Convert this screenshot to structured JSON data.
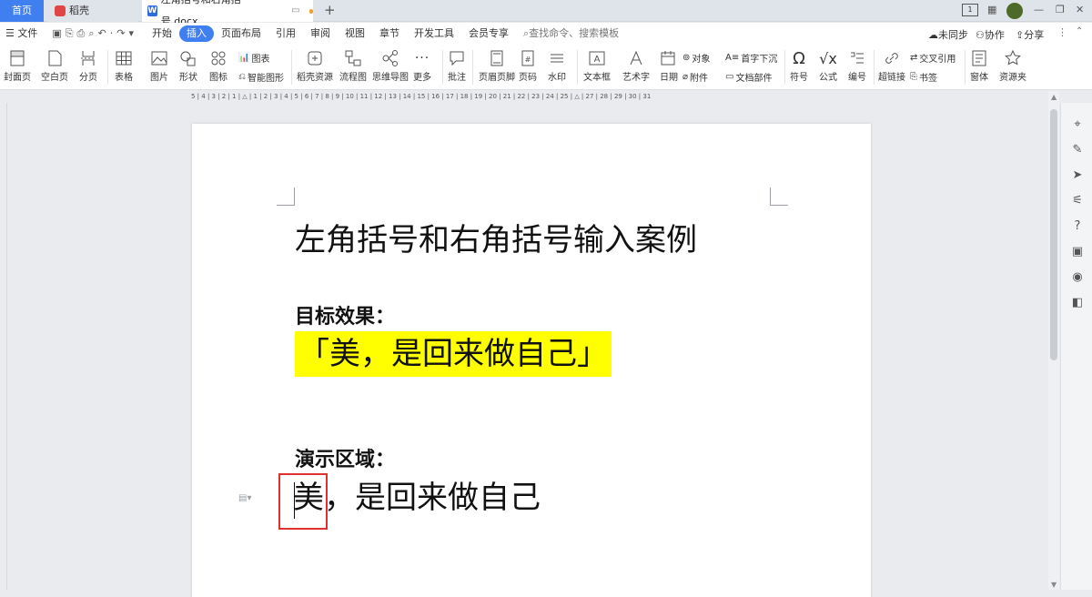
{
  "tabs": {
    "home": "首页",
    "daoke": "稻壳",
    "doc": "左角括号和右角括号.docx",
    "add": "+"
  },
  "window": {
    "page_num": "1",
    "minimize": "—",
    "restore": "❐",
    "close": "✕"
  },
  "menu": {
    "file": "文件",
    "items": [
      "开始",
      "插入",
      "页面布局",
      "引用",
      "审阅",
      "视图",
      "章节",
      "开发工具",
      "会员专享"
    ],
    "active": "插入",
    "search": "查找命令、搜索模板",
    "sync": "未同步",
    "collab": "协作",
    "share": "分享"
  },
  "ribbon": {
    "cover": "封面页",
    "blank": "空白页",
    "pagebreak": "分页",
    "table": "表格",
    "picture": "图片",
    "shape": "形状",
    "icon": "图标",
    "chart": "图表",
    "smartart": "智能图形",
    "daoke_res": "稻壳资源",
    "flowchart": "流程图",
    "mindmap": "思维导图",
    "more": "更多",
    "comment": "批注",
    "header_footer": "页眉页脚",
    "page_num": "页码",
    "watermark": "水印",
    "textbox": "文本框",
    "wordart": "艺术字",
    "date": "日期",
    "object": "对象",
    "attachment": "附件",
    "dropcap": "首字下沉",
    "doc_part": "文档部件",
    "symbol": "符号",
    "formula": "公式",
    "numbering": "编号",
    "cross_ref": "交叉引用",
    "hyperlink": "超链接",
    "bookmark": "书签",
    "window_elem": "窗体",
    "resources": "资源夹"
  },
  "ruler": {
    "text": "5 | 4 | 3 | 2 | 1 | △ | 1 | 2 | 3 | 4 | 5 | 6 | 7 | 8 | 9 | 10 | 11 | 12 | 13 | 14 | 15 | 16 | 17 | 18 | 19 | 20 | 21 | 22 | 23 | 24 | 25 | △ | 27 | 28 | 29 | 30 | 31"
  },
  "document": {
    "title": "左角括号和右角括号输入案例",
    "target_label": "目标效果：",
    "target_text": "「美，是回来做自己」",
    "demo_label": "演示区域：",
    "demo_text": "美，是回来做自己"
  },
  "colors": {
    "accent": "#3f7ff0",
    "highlight": "#ffff00",
    "cursor_box": "#e03030"
  }
}
